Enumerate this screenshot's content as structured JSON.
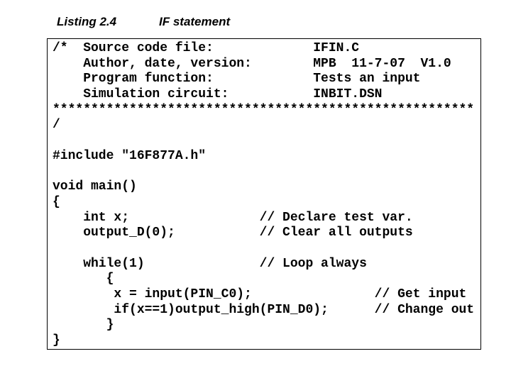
{
  "header": {
    "listing_label": "Listing 2.4",
    "listing_title": "IF statement"
  },
  "code": {
    "language": "C",
    "lines": [
      "/*  Source code file:             IFIN.C",
      "    Author, date, version:        MPB  11-7-07  V1.0",
      "    Program function:             Tests an input",
      "    Simulation circuit:           INBIT.DSN",
      "*******************************************************",
      "/",
      "",
      "#include \"16F877A.h\"",
      "",
      "void main()",
      "{",
      "    int x;                 // Declare test var.",
      "    output_D(0);           // Clear all outputs",
      "",
      "    while(1)               // Loop always",
      "       {",
      "        x = input(PIN_C0);                // Get input",
      "        if(x==1)output_high(PIN_D0);      // Change out",
      "       }",
      "}"
    ]
  }
}
